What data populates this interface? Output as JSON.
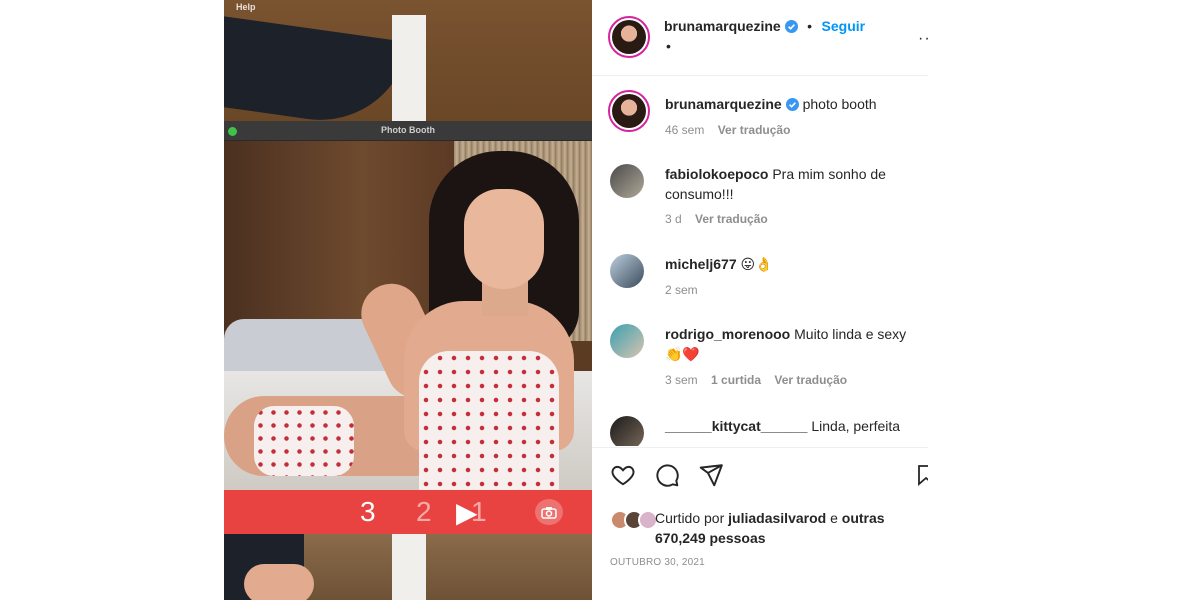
{
  "media": {
    "menu_help": "Help",
    "window_title": "Photo Booth",
    "countdown": [
      "3",
      "2",
      "1"
    ]
  },
  "post": {
    "author": "brunamarquezine",
    "follow_label": "Seguir",
    "separator": "•",
    "caption": "photo booth",
    "caption_time": "46 sem",
    "translate_label": "Ver tradução",
    "more_icon": "more-icon",
    "colors": {
      "accent": "#0095f6",
      "verified": "#3897f0",
      "muted": "#8e8e8e",
      "countdown_bar": "#e84341"
    }
  },
  "comments": [
    {
      "user": "fabiolokoepoco",
      "text": "Pra mim sonho de consumo!!!",
      "time": "3 d",
      "likes": "",
      "translate": "Ver tradução"
    },
    {
      "user": "michelj677",
      "text": "😛👌",
      "time": "2 sem",
      "likes": "",
      "translate": ""
    },
    {
      "user": "rodrigo_morenooo",
      "text": "Muito linda e sexy 👏❤️",
      "time": "3 sem",
      "likes": "1 curtida",
      "translate": "Ver tradução"
    },
    {
      "user": "______kittycat______",
      "text": "Linda, perfeita",
      "time": "",
      "likes": "",
      "translate": ""
    }
  ],
  "actions": {
    "liked_by_prefix": "Curtido por",
    "liked_by_user": "juliadasilvarod",
    "liked_by_suffix": "e",
    "others": "outras 670,249 pessoas",
    "date": "OUTUBRO 30, 2021"
  }
}
